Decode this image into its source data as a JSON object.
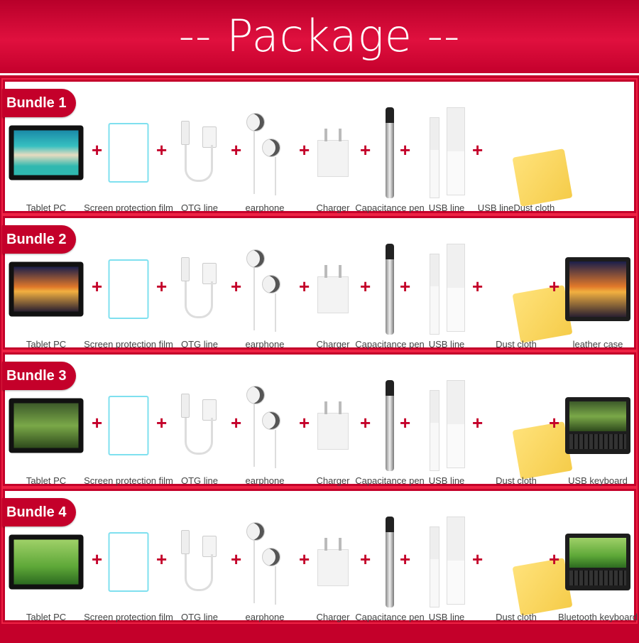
{
  "title": "-- Package --",
  "colors": {
    "brand_red": "#c4002a",
    "film_border": "#7fe0ef",
    "cloth": "#f5cc4a"
  },
  "bundles": [
    {
      "label": "Bundle 1",
      "screen": "linear-gradient(180deg,#1a8aa8 0%,#36c0c0 35%,#e8dcc0 55%,#2fb8b0 80%)",
      "items": [
        {
          "type": "tablet",
          "label": "Tablet PC"
        },
        {
          "type": "film",
          "label": "Screen protection film"
        },
        {
          "type": "otg",
          "label": "OTG line"
        },
        {
          "type": "earphone",
          "label": "earphone"
        },
        {
          "type": "charger",
          "label": "Charger"
        },
        {
          "type": "pen",
          "label": "Capacitance pen"
        },
        {
          "type": "usb",
          "label": "USB line"
        },
        {
          "type": "cloth",
          "label": "USB lineDust cloth"
        }
      ]
    },
    {
      "label": "Bundle 2",
      "screen": "linear-gradient(180deg,#1b1f4a 0%,#e0782a 45%,#f2b040 55%,#2a2030 100%)",
      "items": [
        {
          "type": "tablet",
          "label": "Tablet PC"
        },
        {
          "type": "film",
          "label": "Screen protection film"
        },
        {
          "type": "otg",
          "label": "OTG line"
        },
        {
          "type": "earphone",
          "label": "earphone"
        },
        {
          "type": "charger",
          "label": "Charger"
        },
        {
          "type": "pen",
          "label": "Capacitance pen"
        },
        {
          "type": "usb",
          "label": "USB line"
        },
        {
          "type": "cloth",
          "label": "Dust cloth"
        },
        {
          "type": "case",
          "label": "leather case"
        }
      ]
    },
    {
      "label": "Bundle 3",
      "screen": "linear-gradient(180deg,#3d5a2a 0%,#7aa848 50%,#2e4a1c 100%)",
      "items": [
        {
          "type": "tablet",
          "label": "Tablet PC"
        },
        {
          "type": "film",
          "label": "Screen protection film"
        },
        {
          "type": "otg",
          "label": "OTG line"
        },
        {
          "type": "earphone",
          "label": "earphone"
        },
        {
          "type": "charger",
          "label": "Charger"
        },
        {
          "type": "pen",
          "label": "Capacitance pen"
        },
        {
          "type": "usb",
          "label": "USB line"
        },
        {
          "type": "cloth",
          "label": "Dust cloth"
        },
        {
          "type": "keyboard",
          "label": "USB keyboard"
        }
      ]
    },
    {
      "label": "Bundle 4",
      "screen": "linear-gradient(180deg,#9fd068 0%,#5ea838 60%,#2c6a20 100%)",
      "items": [
        {
          "type": "tablet",
          "label": "Tablet PC"
        },
        {
          "type": "film",
          "label": "Screen protection film"
        },
        {
          "type": "otg",
          "label": "OTG line"
        },
        {
          "type": "earphone",
          "label": "earphone"
        },
        {
          "type": "charger",
          "label": "Charger"
        },
        {
          "type": "pen",
          "label": "Capacitance pen"
        },
        {
          "type": "usb",
          "label": "USB line"
        },
        {
          "type": "cloth",
          "label": "Dust cloth"
        },
        {
          "type": "keyboard",
          "label": "Bluetooth keyboard"
        }
      ]
    }
  ]
}
